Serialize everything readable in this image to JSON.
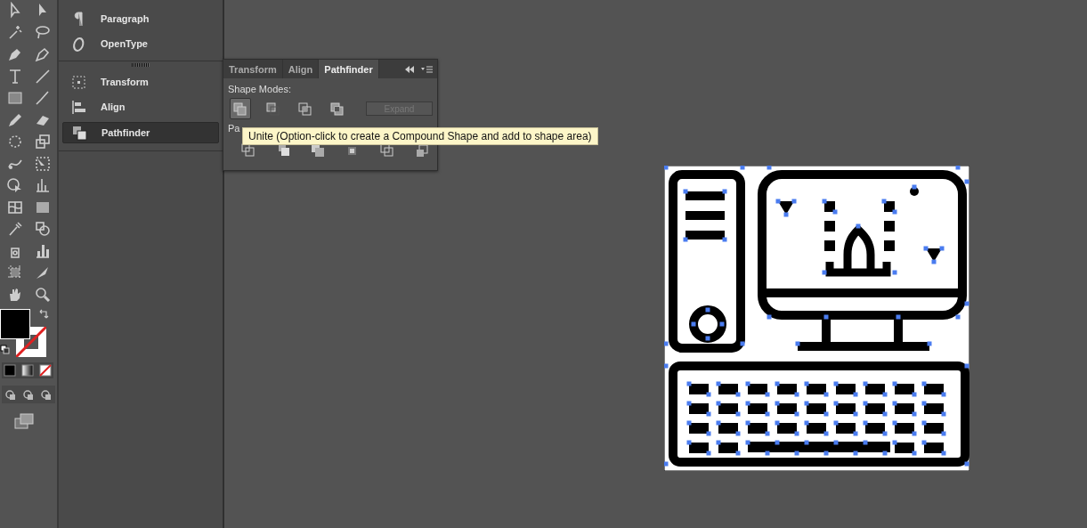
{
  "dock": {
    "groups": [
      {
        "items": [
          {
            "label": "Paragraph",
            "selected": false,
            "kind": "paragraph"
          },
          {
            "label": "OpenType",
            "selected": false,
            "kind": "opentype"
          }
        ]
      },
      {
        "items": [
          {
            "label": "Transform",
            "selected": false,
            "kind": "transform"
          },
          {
            "label": "Align",
            "selected": false,
            "kind": "align"
          },
          {
            "label": "Pathfinder",
            "selected": true,
            "kind": "pathfinder"
          }
        ]
      }
    ]
  },
  "pathfinder_panel": {
    "tabs": [
      {
        "label": "Transform",
        "selected": false
      },
      {
        "label": "Align",
        "selected": false
      },
      {
        "label": "Pathfinder",
        "selected": true
      }
    ],
    "shape_modes_label": "Shape Modes:",
    "shape_modes": [
      {
        "selected": true
      },
      {
        "selected": false
      },
      {
        "selected": false
      },
      {
        "selected": false
      }
    ],
    "expand_button": {
      "label": "Expand",
      "disabled": true
    },
    "pathfinders_label": "Pa"
  },
  "tooltip": "Unite (Option-click to create a Compound Shape and add to shape area)"
}
